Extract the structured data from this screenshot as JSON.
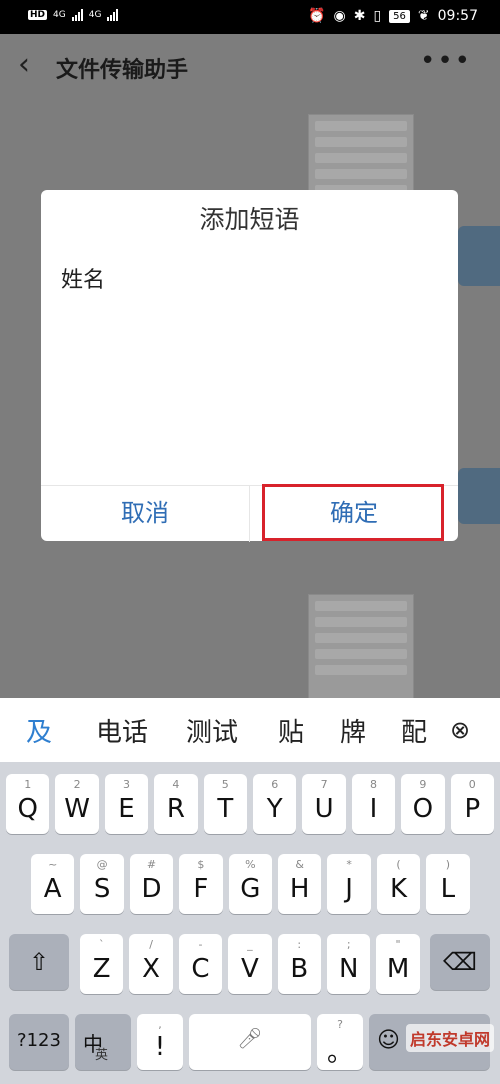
{
  "status_bar": {
    "network_left": "HD",
    "signal1": "4G",
    "signal2": "4G",
    "battery": "56",
    "time": "09:57"
  },
  "header": {
    "title": "文件传输助手"
  },
  "dialog": {
    "title": "添加短语",
    "input_value": "姓名",
    "cancel_label": "取消",
    "confirm_label": "确定"
  },
  "candidates": [
    "及",
    "电话",
    "测试",
    "贴",
    "牌",
    "配"
  ],
  "keyboard": {
    "row1": [
      [
        "1",
        "Q"
      ],
      [
        "2",
        "W"
      ],
      [
        "3",
        "E"
      ],
      [
        "4",
        "R"
      ],
      [
        "5",
        "T"
      ],
      [
        "6",
        "Y"
      ],
      [
        "7",
        "U"
      ],
      [
        "8",
        "I"
      ],
      [
        "9",
        "O"
      ],
      [
        "0",
        "P"
      ]
    ],
    "row2": [
      [
        "~",
        "A"
      ],
      [
        "@",
        "S"
      ],
      [
        "#",
        "D"
      ],
      [
        "$",
        "F"
      ],
      [
        "%",
        "G"
      ],
      [
        "&",
        "H"
      ],
      [
        "*",
        "J"
      ],
      [
        "(",
        "K"
      ],
      [
        ")",
        "L"
      ]
    ],
    "row3": [
      [
        "`",
        "Z"
      ],
      [
        "/",
        "X"
      ],
      [
        "-",
        "C"
      ],
      [
        "_",
        "V"
      ],
      [
        ":",
        "B"
      ],
      [
        ";",
        "N"
      ],
      [
        "\"",
        "M"
      ]
    ],
    "numeric_label": "?123",
    "lang_label": "中",
    "lang_sub": "英",
    "punct_main": "!",
    "punct_sub": ",",
    "question_sub": "?",
    "period_main": "。"
  },
  "watermark": "启东安卓网"
}
